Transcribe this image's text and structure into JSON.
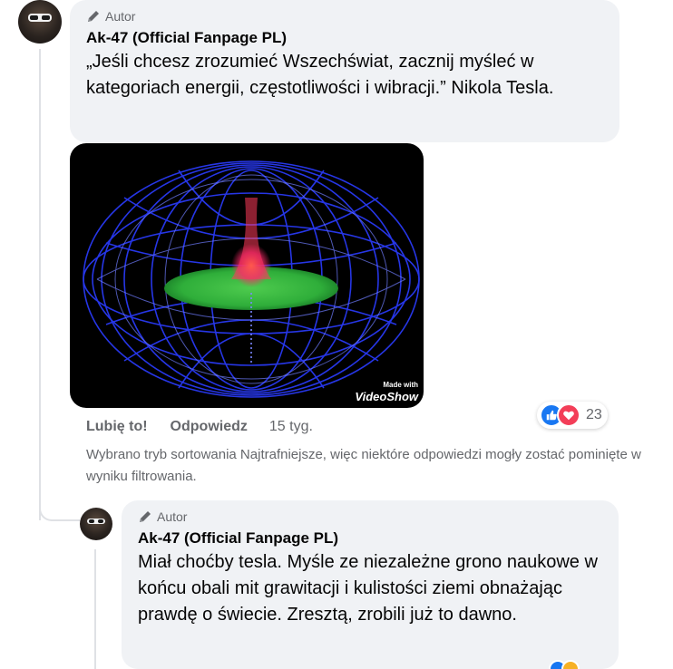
{
  "comment": {
    "badge_label": "Autor",
    "author": "Ak-47 (Official Fanpage PL)",
    "text": "„Jeśli chcesz zrozumieć Wszechświat, zacznij myśleć w kategoriach energii, częstotliwości i wibracji.” Nikola Tesla.",
    "media": {
      "watermark_small": "Made with",
      "watermark_brand": "VideoShow"
    },
    "actions": {
      "like": "Lubię to!",
      "reply": "Odpowiedz",
      "time": "15 tyg."
    },
    "reactions": {
      "icons": [
        "like-icon",
        "love-icon"
      ],
      "count": "23",
      "colors": {
        "like": "#1877f2",
        "love": "#f33e58"
      }
    }
  },
  "sort_notice": "Wybrano tryb sortowania Najtrafniejsze, więc niektóre odpowiedzi mogły zostać pominięte w wyniku filtrowania.",
  "reply": {
    "badge_label": "Autor",
    "author": "Ak-47 (Official Fanpage PL)",
    "text": "Miał choćby tesla. Myśle ze niezależne grono naukowe w końcu obali mit grawitacji i kulistości ziemi obnażając prawdę o świecie. Zresztą, zrobili już to dawno."
  },
  "colors": {
    "bubble_bg": "#f0f2f5",
    "secondary_text": "#65676b",
    "thread_line": "#dfe1e5"
  }
}
